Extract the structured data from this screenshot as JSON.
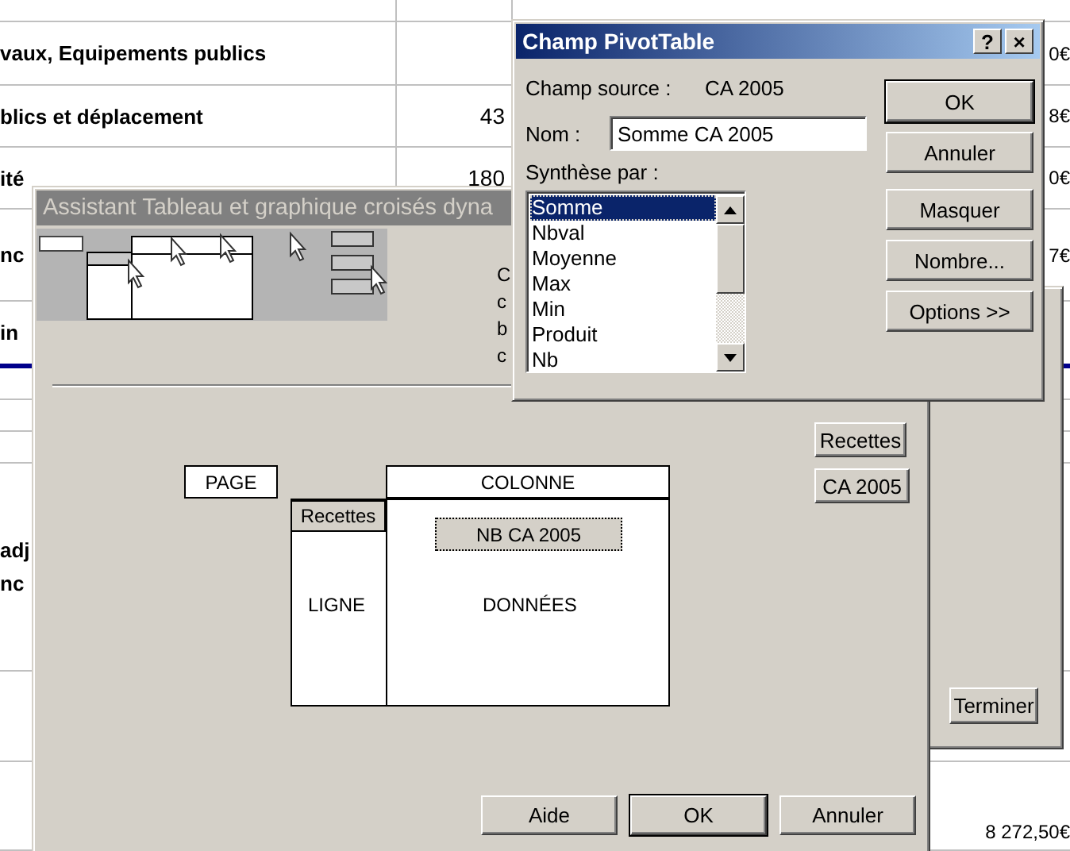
{
  "spreadsheet": {
    "rows": [
      {},
      {
        "label": "vaux, Equipements publics",
        "amount": "0€"
      },
      {
        "label": "blics et déplacement",
        "value": "43",
        "amount": "8€"
      },
      {
        "label": "ité",
        "value": "180",
        "amount": "0€"
      },
      {
        "label": "nc",
        "amount": "7€"
      },
      {
        "label": "in"
      },
      {},
      {},
      {},
      {
        "label": "adj\nnc"
      },
      {},
      {
        "amount": "8 272,50€"
      }
    ]
  },
  "background_wizard": {
    "buttons": [
      {
        "label": "Terminer",
        "default": false
      }
    ]
  },
  "layout_wizard": {
    "title": "Assistant Tableau et graphique croisés dyna",
    "active": false,
    "cut_text": [
      "C",
      "c",
      "b",
      "c"
    ],
    "page_zone": "PAGE",
    "column_zone": "COLONNE",
    "row_zone": {
      "label": "LIGNE",
      "fields": [
        "Recettes"
      ]
    },
    "data_zone": {
      "label": "DONNÉES",
      "fields": [
        "NB CA 2005"
      ]
    },
    "available_fields": [
      "Recettes",
      "CA 2005"
    ],
    "buttons": [
      {
        "label": "Aide",
        "default": false
      },
      {
        "label": "OK",
        "default": true
      },
      {
        "label": "Annuler",
        "default": false
      }
    ]
  },
  "pivot_field_dialog": {
    "title": "Champ PivotTable",
    "active": true,
    "title_buttons": [
      "?",
      "×"
    ],
    "source_label": "Champ source :",
    "source_value": "CA 2005",
    "name_label": "Nom :",
    "name_value": "Somme CA 2005",
    "summary_label": "Synthèse par :",
    "functions": [
      {
        "label": "Somme",
        "selected": true
      },
      {
        "label": "Nbval",
        "selected": false
      },
      {
        "label": "Moyenne",
        "selected": false
      },
      {
        "label": "Max",
        "selected": false
      },
      {
        "label": "Min",
        "selected": false
      },
      {
        "label": "Produit",
        "selected": false
      },
      {
        "label": "Nb",
        "selected": false
      }
    ],
    "buttons": [
      {
        "label": "OK",
        "default": true
      },
      {
        "label": "Annuler",
        "default": false
      },
      {
        "label": "Masquer",
        "default": false
      },
      {
        "label": "Nombre...",
        "default": false
      },
      {
        "label": "Options >>",
        "default": false
      }
    ]
  }
}
